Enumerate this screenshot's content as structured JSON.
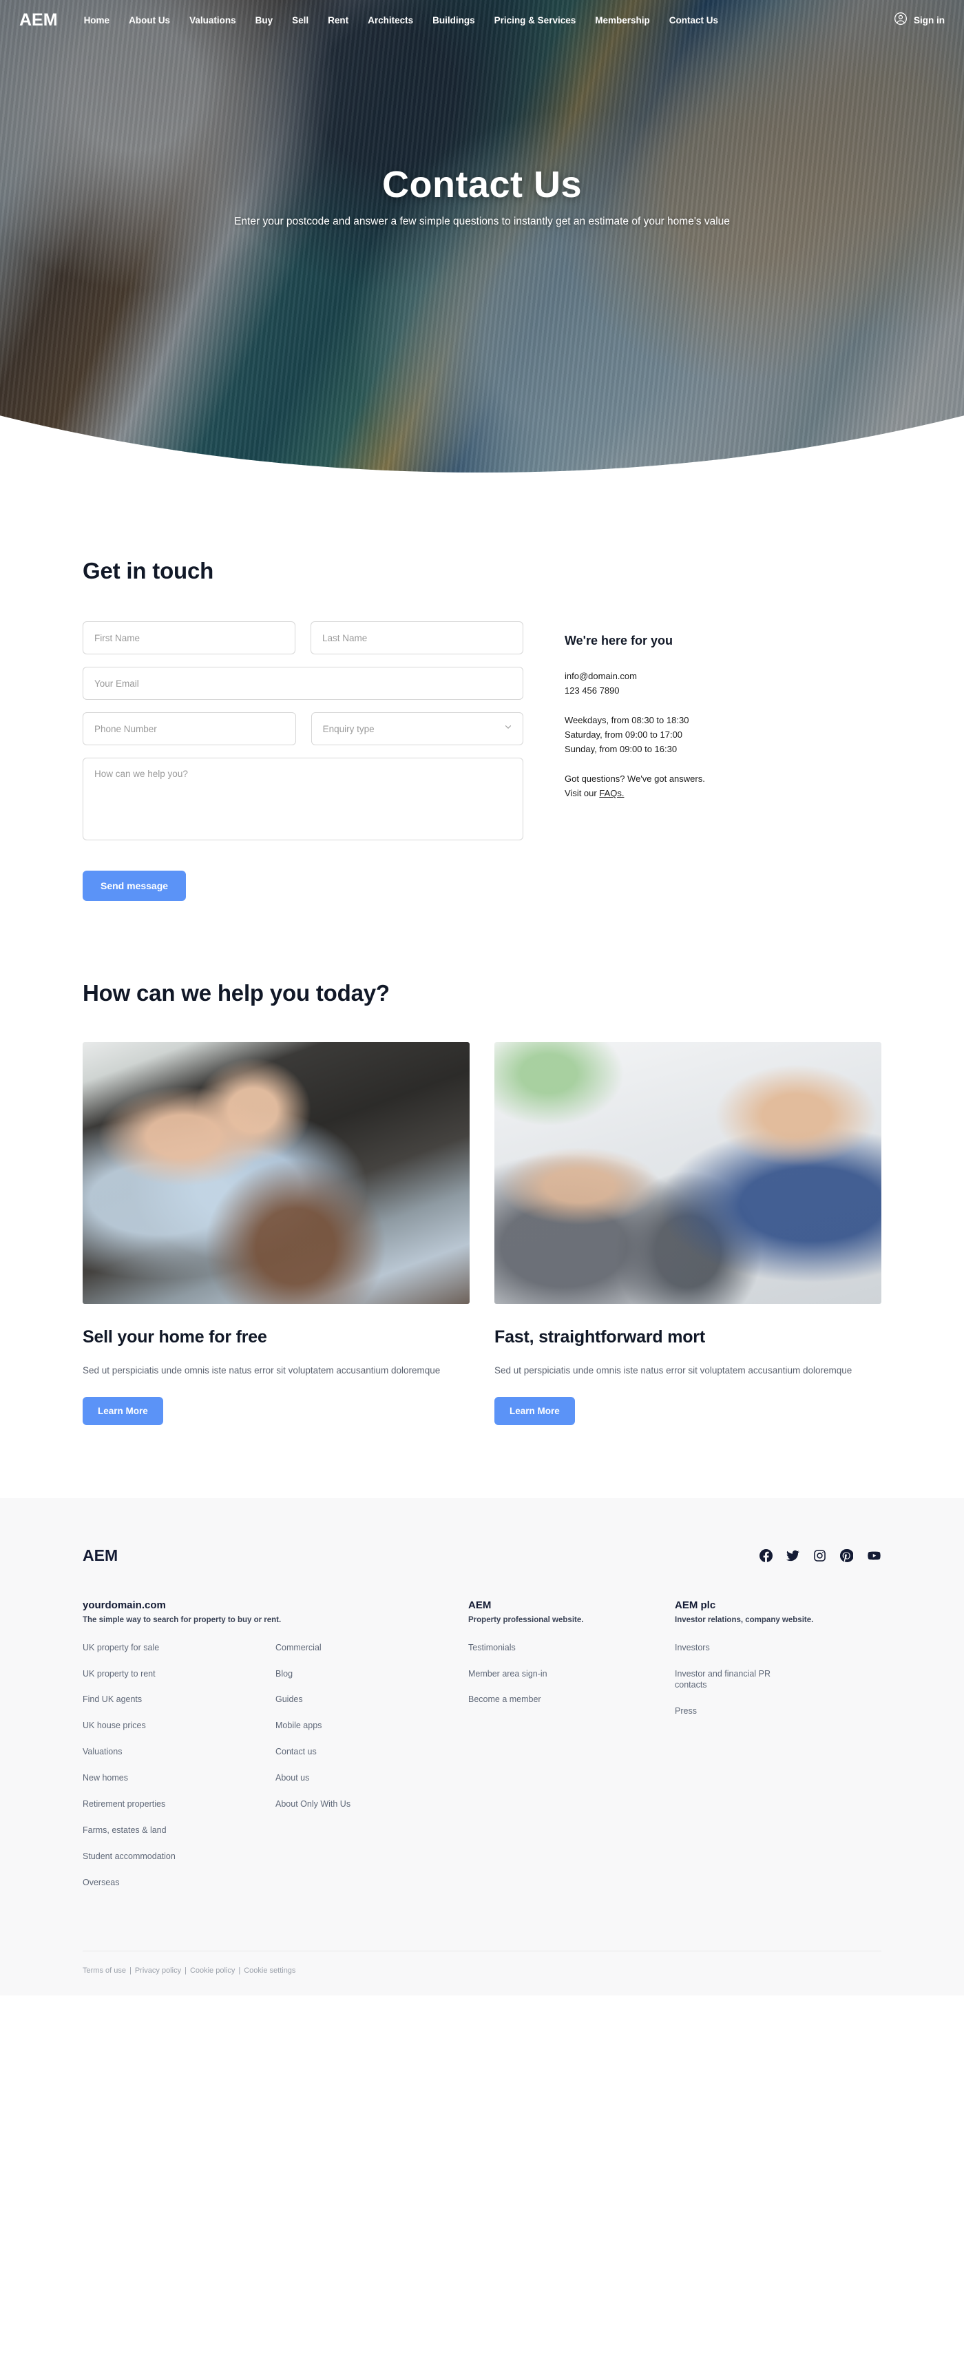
{
  "navbar": {
    "brand": "AEM",
    "links": [
      {
        "label": "Home"
      },
      {
        "label": "About Us"
      },
      {
        "label": "Valuations"
      },
      {
        "label": "Buy"
      },
      {
        "label": "Sell"
      },
      {
        "label": "Rent"
      },
      {
        "label": "Architects"
      },
      {
        "label": "Buildings"
      },
      {
        "label": "Pricing & Services"
      },
      {
        "label": "Membership"
      },
      {
        "label": "Contact Us"
      }
    ],
    "signin_label": "Sign in",
    "signin_icon": "user-circle-icon"
  },
  "hero": {
    "title": "Contact Us",
    "subtitle": "Enter your postcode and answer a few simple questions to instantly get an estimate of your home's value"
  },
  "contact": {
    "heading": "Get in touch",
    "form": {
      "first_name_placeholder": "First Name",
      "first_name_value": "",
      "last_name_placeholder": "Last Name",
      "last_name_value": "",
      "email_placeholder": "Your Email",
      "email_value": "",
      "phone_placeholder": "Phone Number",
      "phone_value": "",
      "enquiry_placeholder": "Enquiry type",
      "enquiry_value": "",
      "enquiry_chevron": "chevron-down-icon",
      "message_placeholder": "How can we help you?",
      "message_value": "",
      "submit_label": "Send message"
    },
    "info": {
      "title": "We're here for you",
      "email": "info@domain.com",
      "phone": "123 456 7890",
      "hours": [
        "Weekdays, from 08:30 to 18:30",
        "Saturday, from 09:00 to 17:00",
        "Sunday, from 09:00 to 16:30"
      ],
      "faq_line": "Got questions? We've got answers.",
      "faq_prefix": "Visit our ",
      "faq_link": "FAQs."
    }
  },
  "help": {
    "heading": "How can we help you today?",
    "cards": [
      {
        "image_name": "couple-with-agent-photo",
        "title": "Sell your home for free",
        "text": "Sed ut perspiciatis unde omnis iste natus error sit voluptatem accusantium doloremque",
        "button": "Learn More"
      },
      {
        "image_name": "mortgage-handshake-photo",
        "title": "Fast, straightforward mort",
        "text": "Sed ut perspiciatis unde omnis iste natus error sit voluptatem accusantium doloremque",
        "button": "Learn More"
      }
    ]
  },
  "footer": {
    "brand": "AEM",
    "socials": [
      {
        "name": "facebook-icon"
      },
      {
        "name": "twitter-icon"
      },
      {
        "name": "instagram-icon"
      },
      {
        "name": "pinterest-icon"
      },
      {
        "name": "youtube-icon"
      }
    ],
    "columns": [
      {
        "head": "yourdomain.com",
        "sub": "The simple way to search for property to buy or rent.",
        "links_a": [
          "UK property for sale",
          "UK property to rent",
          "Find UK agents",
          "UK house prices",
          "Valuations",
          "New homes",
          "Retirement properties",
          "Farms, estates & land",
          "Student accommodation",
          "Overseas"
        ],
        "links_b": [
          "Commercial",
          "Blog",
          "Guides",
          "Mobile apps",
          "Contact us",
          "About us",
          "About Only With Us"
        ]
      },
      {
        "head": "AEM",
        "sub": "Property professional website.",
        "links_a": [
          "Testimonials",
          "Member area sign-in",
          "Become a member"
        ],
        "links_b": []
      },
      {
        "head": "AEM plc",
        "sub": "Investor relations, company website.",
        "links_a": [
          "Investors",
          "Investor and financial PR contacts",
          "Press"
        ],
        "links_b": []
      }
    ],
    "legal": [
      "Terms of use",
      "Privacy policy",
      "Cookie policy",
      "Cookie settings"
    ]
  },
  "colors": {
    "accent_blue": "#5b93f7",
    "footer_bg": "#f8f8f9",
    "ink": "#141b34",
    "muted": "#5f6878"
  }
}
